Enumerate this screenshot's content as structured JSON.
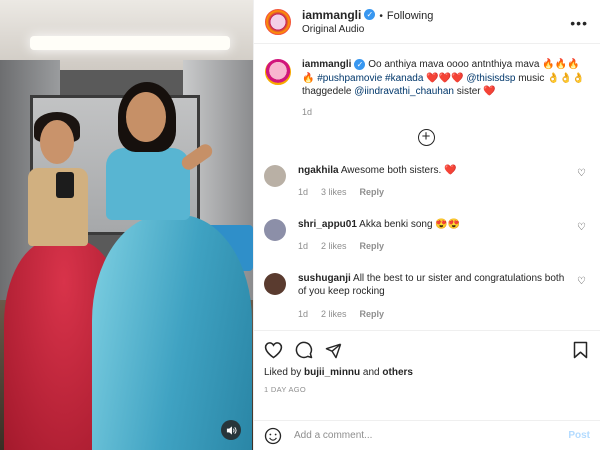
{
  "header": {
    "username": "iammangli",
    "follow_status": "Following",
    "audio_label": "Original Audio",
    "more": "•••"
  },
  "caption": {
    "username": "iammangli",
    "text1": "Oo anthiya mava oooo antnthiya mava",
    "emoji1": "🔥🔥🔥🔥",
    "hashtags": "#pushpamovie #kanada",
    "hearts": "❤️❤️❤️",
    "mention1": "@thisisdsp",
    "text2": "music",
    "emoji2": "👌👌👌",
    "text3": "thaggedele",
    "mention2": "@iindravathi_chauhan",
    "text4": "sister",
    "heart_end": "❤️",
    "time": "1d"
  },
  "comments": [
    {
      "username": "ngakhila",
      "text": "Awesome both sisters. ❤️",
      "time": "1d",
      "likes": "3 likes",
      "reply": "Reply",
      "avatar_color": "#b9b0a5"
    },
    {
      "username": "shri_appu01",
      "text": "Akka benki song 😍😍",
      "time": "1d",
      "likes": "2 likes",
      "reply": "Reply",
      "avatar_color": "#8c8fa8"
    },
    {
      "username": "sushuganji",
      "text": "All the best to ur sister and congratulations both of you keep rocking",
      "time": "1d",
      "likes": "2 likes",
      "reply": "Reply",
      "avatar_color": "#5a3b2f"
    }
  ],
  "actions": {
    "liked_by_prefix": "Liked by",
    "liked_by_user": "bujii_minnu",
    "liked_by_and": "and",
    "liked_by_others": "others",
    "ago": "1 DAY AGO"
  },
  "add_comment": {
    "placeholder": "Add a comment...",
    "post": "Post"
  },
  "colors": {
    "link": "#00376b",
    "verified": "#3897f0",
    "muted": "#8e8e8e",
    "post_disabled": "#b3dbff"
  }
}
